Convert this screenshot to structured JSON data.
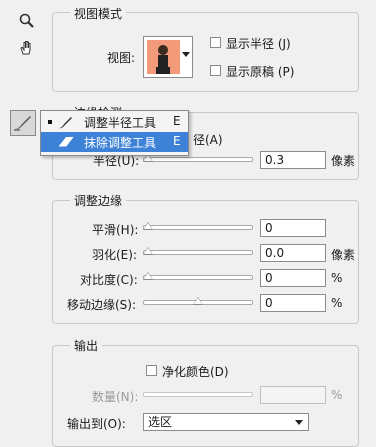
{
  "view_mode": {
    "legend": "视图模式",
    "view_label": "视图:",
    "show_radius": "显示半径 (J)",
    "show_original": "显示原稿 (P)"
  },
  "edge_detection": {
    "legend": "边缘检测",
    "smart_radius_tail": "径(A)",
    "radius_label": "半径(U):",
    "radius_value": "0.3",
    "radius_unit": "像素"
  },
  "tool_menu": {
    "items": [
      {
        "label": "调整半径工具",
        "shortcut": "E"
      },
      {
        "label": "抹除调整工具",
        "shortcut": "E"
      }
    ]
  },
  "adjust_edge": {
    "legend": "调整边缘",
    "smooth_label": "平滑(H):",
    "smooth_value": "0",
    "feather_label": "羽化(E):",
    "feather_value": "0.0",
    "feather_unit": "像素",
    "contrast_label": "对比度(C):",
    "contrast_value": "0",
    "contrast_unit": "%",
    "shift_label": "移动边缘(S):",
    "shift_value": "0",
    "shift_unit": "%"
  },
  "output": {
    "legend": "输出",
    "decontaminate": "净化颜色(D)",
    "amount_label": "数量(N):",
    "amount_unit": "%",
    "output_to_label": "输出到(O):",
    "output_to_value": "选区"
  },
  "slider_levels": {
    "radius": 0.0,
    "smooth": 0.0,
    "feather": 0.0,
    "contrast": 0.0,
    "shift": 0.5
  },
  "colors": {
    "menu_highlight": "#3d82d6",
    "thumbnail_bg": "#f29a7a"
  }
}
